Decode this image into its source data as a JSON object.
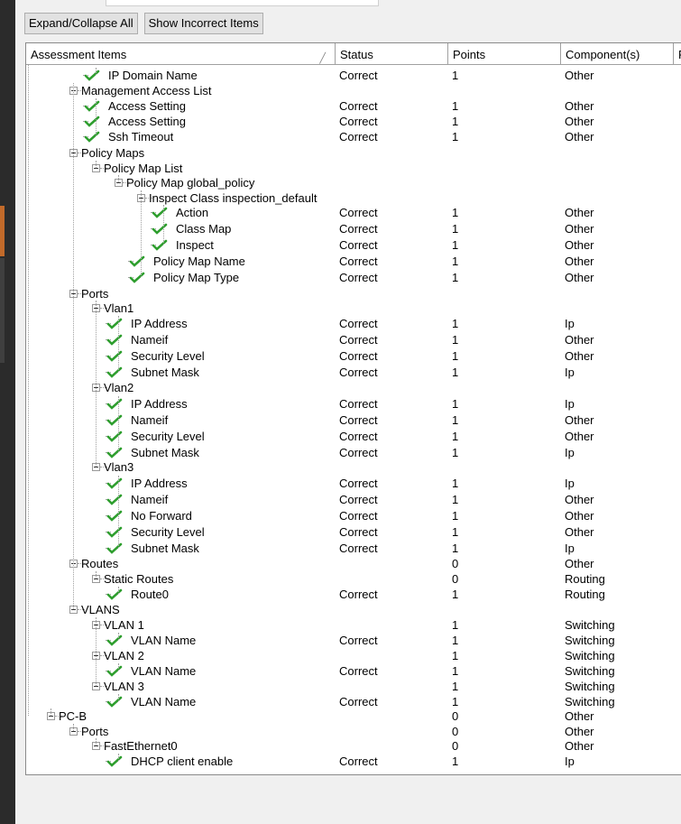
{
  "toolbar": {
    "expand_label": "Expand/Collapse All",
    "incorrect_label": "Show Incorrect Items"
  },
  "columns": {
    "items": "Assessment Items",
    "status": "Status",
    "points": "Points",
    "components": "Component(s)",
    "extra": "F"
  },
  "colors": {
    "check": "#2e9e2e",
    "accent": "#c26a2a"
  },
  "rows": [
    {
      "label": "IP Domain Name",
      "level": 2,
      "type": "leaf",
      "status": "Correct",
      "points": "1",
      "component": "Other"
    },
    {
      "label": "Management Access List",
      "level": 1,
      "type": "group",
      "status": "",
      "points": "",
      "component": ""
    },
    {
      "label": "Access Setting",
      "level": 2,
      "type": "leaf",
      "status": "Correct",
      "points": "1",
      "component": "Other"
    },
    {
      "label": "Access Setting",
      "level": 2,
      "type": "leaf",
      "status": "Correct",
      "points": "1",
      "component": "Other"
    },
    {
      "label": "Ssh Timeout",
      "level": 2,
      "type": "leaf",
      "status": "Correct",
      "points": "1",
      "component": "Other"
    },
    {
      "label": "Policy Maps",
      "level": 1,
      "type": "group",
      "status": "",
      "points": "",
      "component": ""
    },
    {
      "label": "Policy Map List",
      "level": 2,
      "type": "group",
      "status": "",
      "points": "",
      "component": ""
    },
    {
      "label": "Policy Map global_policy",
      "level": 3,
      "type": "group",
      "status": "",
      "points": "",
      "component": ""
    },
    {
      "label": "Inspect Class inspection_default",
      "level": 4,
      "type": "group",
      "status": "",
      "points": "",
      "component": ""
    },
    {
      "label": "Action",
      "level": 5,
      "type": "leaf",
      "status": "Correct",
      "points": "1",
      "component": "Other"
    },
    {
      "label": "Class Map",
      "level": 5,
      "type": "leaf",
      "status": "Correct",
      "points": "1",
      "component": "Other"
    },
    {
      "label": "Inspect",
      "level": 5,
      "type": "leaf",
      "status": "Correct",
      "points": "1",
      "component": "Other"
    },
    {
      "label": "Policy Map Name",
      "level": 4,
      "type": "leaf",
      "status": "Correct",
      "points": "1",
      "component": "Other"
    },
    {
      "label": "Policy Map Type",
      "level": 4,
      "type": "leaf",
      "status": "Correct",
      "points": "1",
      "component": "Other"
    },
    {
      "label": "Ports",
      "level": 1,
      "type": "group",
      "status": "",
      "points": "",
      "component": ""
    },
    {
      "label": "Vlan1",
      "level": 2,
      "type": "group",
      "status": "",
      "points": "",
      "component": ""
    },
    {
      "label": "IP Address",
      "level": 3,
      "type": "leaf",
      "status": "Correct",
      "points": "1",
      "component": "Ip"
    },
    {
      "label": "Nameif",
      "level": 3,
      "type": "leaf",
      "status": "Correct",
      "points": "1",
      "component": "Other"
    },
    {
      "label": "Security Level",
      "level": 3,
      "type": "leaf",
      "status": "Correct",
      "points": "1",
      "component": "Other"
    },
    {
      "label": "Subnet Mask",
      "level": 3,
      "type": "leaf",
      "status": "Correct",
      "points": "1",
      "component": "Ip"
    },
    {
      "label": "Vlan2",
      "level": 2,
      "type": "group",
      "status": "",
      "points": "",
      "component": ""
    },
    {
      "label": "IP Address",
      "level": 3,
      "type": "leaf",
      "status": "Correct",
      "points": "1",
      "component": "Ip"
    },
    {
      "label": "Nameif",
      "level": 3,
      "type": "leaf",
      "status": "Correct",
      "points": "1",
      "component": "Other"
    },
    {
      "label": "Security Level",
      "level": 3,
      "type": "leaf",
      "status": "Correct",
      "points": "1",
      "component": "Other"
    },
    {
      "label": "Subnet Mask",
      "level": 3,
      "type": "leaf",
      "status": "Correct",
      "points": "1",
      "component": "Ip"
    },
    {
      "label": "Vlan3",
      "level": 2,
      "type": "group",
      "status": "",
      "points": "",
      "component": ""
    },
    {
      "label": "IP Address",
      "level": 3,
      "type": "leaf",
      "status": "Correct",
      "points": "1",
      "component": "Ip"
    },
    {
      "label": "Nameif",
      "level": 3,
      "type": "leaf",
      "status": "Correct",
      "points": "1",
      "component": "Other"
    },
    {
      "label": "No Forward",
      "level": 3,
      "type": "leaf",
      "status": "Correct",
      "points": "1",
      "component": "Other"
    },
    {
      "label": "Security Level",
      "level": 3,
      "type": "leaf",
      "status": "Correct",
      "points": "1",
      "component": "Other"
    },
    {
      "label": "Subnet Mask",
      "level": 3,
      "type": "leaf",
      "status": "Correct",
      "points": "1",
      "component": "Ip"
    },
    {
      "label": "Routes",
      "level": 1,
      "type": "group",
      "status": "",
      "points": "0",
      "component": "Other"
    },
    {
      "label": "Static Routes",
      "level": 2,
      "type": "group",
      "status": "",
      "points": "0",
      "component": "Routing"
    },
    {
      "label": "Route0",
      "level": 3,
      "type": "leaf",
      "status": "Correct",
      "points": "1",
      "component": "Routing"
    },
    {
      "label": "VLANS",
      "level": 1,
      "type": "group",
      "status": "",
      "points": "",
      "component": ""
    },
    {
      "label": "VLAN 1",
      "level": 2,
      "type": "group",
      "status": "",
      "points": "1",
      "component": "Switching"
    },
    {
      "label": "VLAN Name",
      "level": 3,
      "type": "leaf",
      "status": "Correct",
      "points": "1",
      "component": "Switching"
    },
    {
      "label": "VLAN 2",
      "level": 2,
      "type": "group",
      "status": "",
      "points": "1",
      "component": "Switching"
    },
    {
      "label": "VLAN Name",
      "level": 3,
      "type": "leaf",
      "status": "Correct",
      "points": "1",
      "component": "Switching"
    },
    {
      "label": "VLAN 3",
      "level": 2,
      "type": "group",
      "status": "",
      "points": "1",
      "component": "Switching"
    },
    {
      "label": "VLAN Name",
      "level": 3,
      "type": "leaf",
      "status": "Correct",
      "points": "1",
      "component": "Switching"
    },
    {
      "label": "PC-B",
      "level": 0,
      "type": "group",
      "status": "",
      "points": "0",
      "component": "Other"
    },
    {
      "label": "Ports",
      "level": 1,
      "type": "group",
      "status": "",
      "points": "0",
      "component": "Other"
    },
    {
      "label": "FastEthernet0",
      "level": 2,
      "type": "group",
      "status": "",
      "points": "0",
      "component": "Other"
    },
    {
      "label": "DHCP client enable",
      "level": 3,
      "type": "leaf",
      "status": "Correct",
      "points": "1",
      "component": "Ip"
    }
  ]
}
